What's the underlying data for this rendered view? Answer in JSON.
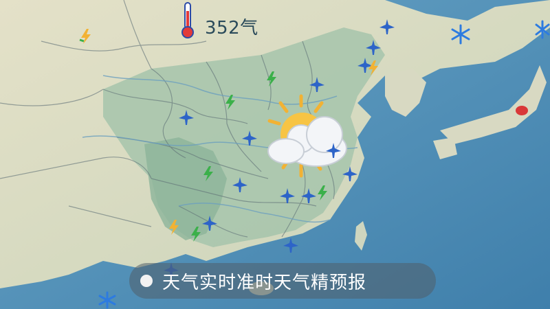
{
  "header": {
    "temperature_label": "352气",
    "thermometer_icon": "thermometer-icon"
  },
  "overlay": {
    "caption": "天气实时准时天气精预报",
    "status_dot_icon": "record-dot-icon"
  },
  "main_weather": {
    "icon": "partly-cloudy-sun-icon"
  },
  "markers": [
    {
      "type": "plane-icon"
    },
    {
      "type": "plane-icon"
    },
    {
      "type": "plane-icon"
    },
    {
      "type": "plane-icon"
    },
    {
      "type": "plane-icon"
    },
    {
      "type": "plane-icon"
    },
    {
      "type": "plane-icon"
    },
    {
      "type": "plane-icon"
    },
    {
      "type": "plane-icon"
    },
    {
      "type": "plane-icon"
    },
    {
      "type": "plane-icon"
    },
    {
      "type": "plane-icon"
    },
    {
      "type": "plane-icon"
    },
    {
      "type": "plane-icon"
    },
    {
      "type": "lightning-icon"
    },
    {
      "type": "lightning-icon"
    },
    {
      "type": "lightning-icon"
    },
    {
      "type": "lightning-icon"
    },
    {
      "type": "lightning-icon"
    },
    {
      "type": "lightning-icon"
    },
    {
      "type": "lightning-icon"
    },
    {
      "type": "lightning-icon"
    },
    {
      "type": "snowflake-icon"
    },
    {
      "type": "snowflake-icon"
    },
    {
      "type": "snowflake-icon"
    },
    {
      "type": "rain-icon"
    }
  ],
  "colors": {
    "sea": "#5b95b8",
    "land_green": "#9dbfa6",
    "land_tan": "#d9d8c0",
    "caption_bg": "rgba(80,95,105,0.55)"
  }
}
